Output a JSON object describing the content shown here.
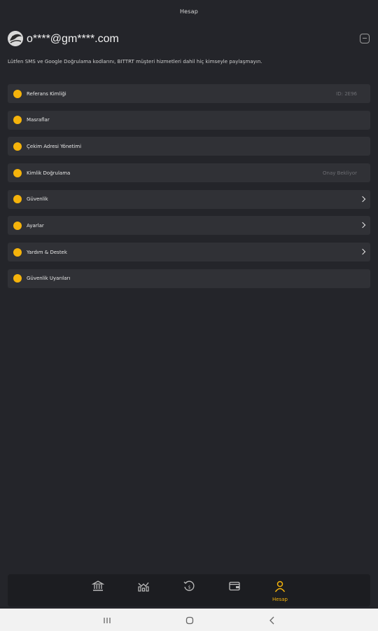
{
  "header": {
    "title": "Hesap"
  },
  "user": {
    "email": "o****@gm****.com"
  },
  "warning_text": "Lütfen SMS ve Google Doğrulama kodlarını, BITTRT müşteri hizmetleri dahil hiç kimseyle paylaşmayın.",
  "menu": [
    {
      "label": "Referans Kimliği",
      "value": "ID: 2E96",
      "chevron": false
    },
    {
      "label": "Masraflar",
      "value": "",
      "chevron": false
    },
    {
      "label": "Çekim Adresi Yönetimi",
      "value": "",
      "chevron": false
    },
    {
      "label": "Kimlik Doğrulama",
      "value": "Onay Bekliyor",
      "chevron": false
    },
    {
      "label": "Güvenlik",
      "value": "",
      "chevron": true
    },
    {
      "label": "Ayarlar",
      "value": "",
      "chevron": true
    },
    {
      "label": "Yardım & Destek",
      "value": "",
      "chevron": true
    },
    {
      "label": "Güvenlik Uyarıları",
      "value": "",
      "chevron": false
    }
  ],
  "tabbar": {
    "tabs": [
      {
        "icon": "bank-icon",
        "label": ""
      },
      {
        "icon": "market-chart-icon",
        "label": ""
      },
      {
        "icon": "history-icon",
        "label": ""
      },
      {
        "icon": "wallet-icon",
        "label": ""
      },
      {
        "icon": "account-icon",
        "label": "Hesap",
        "active": true
      }
    ]
  },
  "colors": {
    "accent": "#f5b30b",
    "background": "#24252a",
    "card": "#303136",
    "tabbar": "#1c1d21"
  }
}
